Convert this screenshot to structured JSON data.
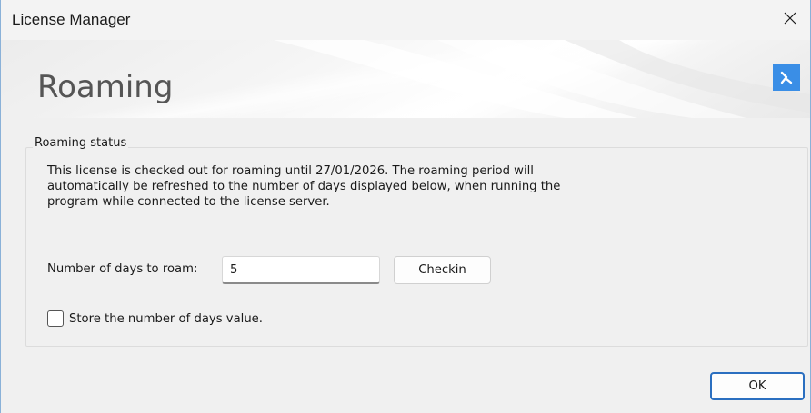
{
  "window": {
    "title": "License Manager",
    "close_icon": "close-icon"
  },
  "banner": {
    "title": "Roaming",
    "logo_icon": "bricscad-logo-icon",
    "logo_color": "#3a8ee6"
  },
  "roaming_status": {
    "group_label": "Roaming status",
    "description_lines": [
      "This license is checked out for roaming until 27/01/2026. The roaming period will",
      "automatically be refreshed to the number of days displayed below, when running the",
      "program while connected to the license server."
    ],
    "days_label": "Number of days to roam:",
    "days_value": "5",
    "checkin_label": "Checkin",
    "store_days_label": "Store the number of days value.",
    "store_days_checked": false
  },
  "footer": {
    "ok_label": "OK",
    "ok_border_color": "#2b6fc0"
  }
}
